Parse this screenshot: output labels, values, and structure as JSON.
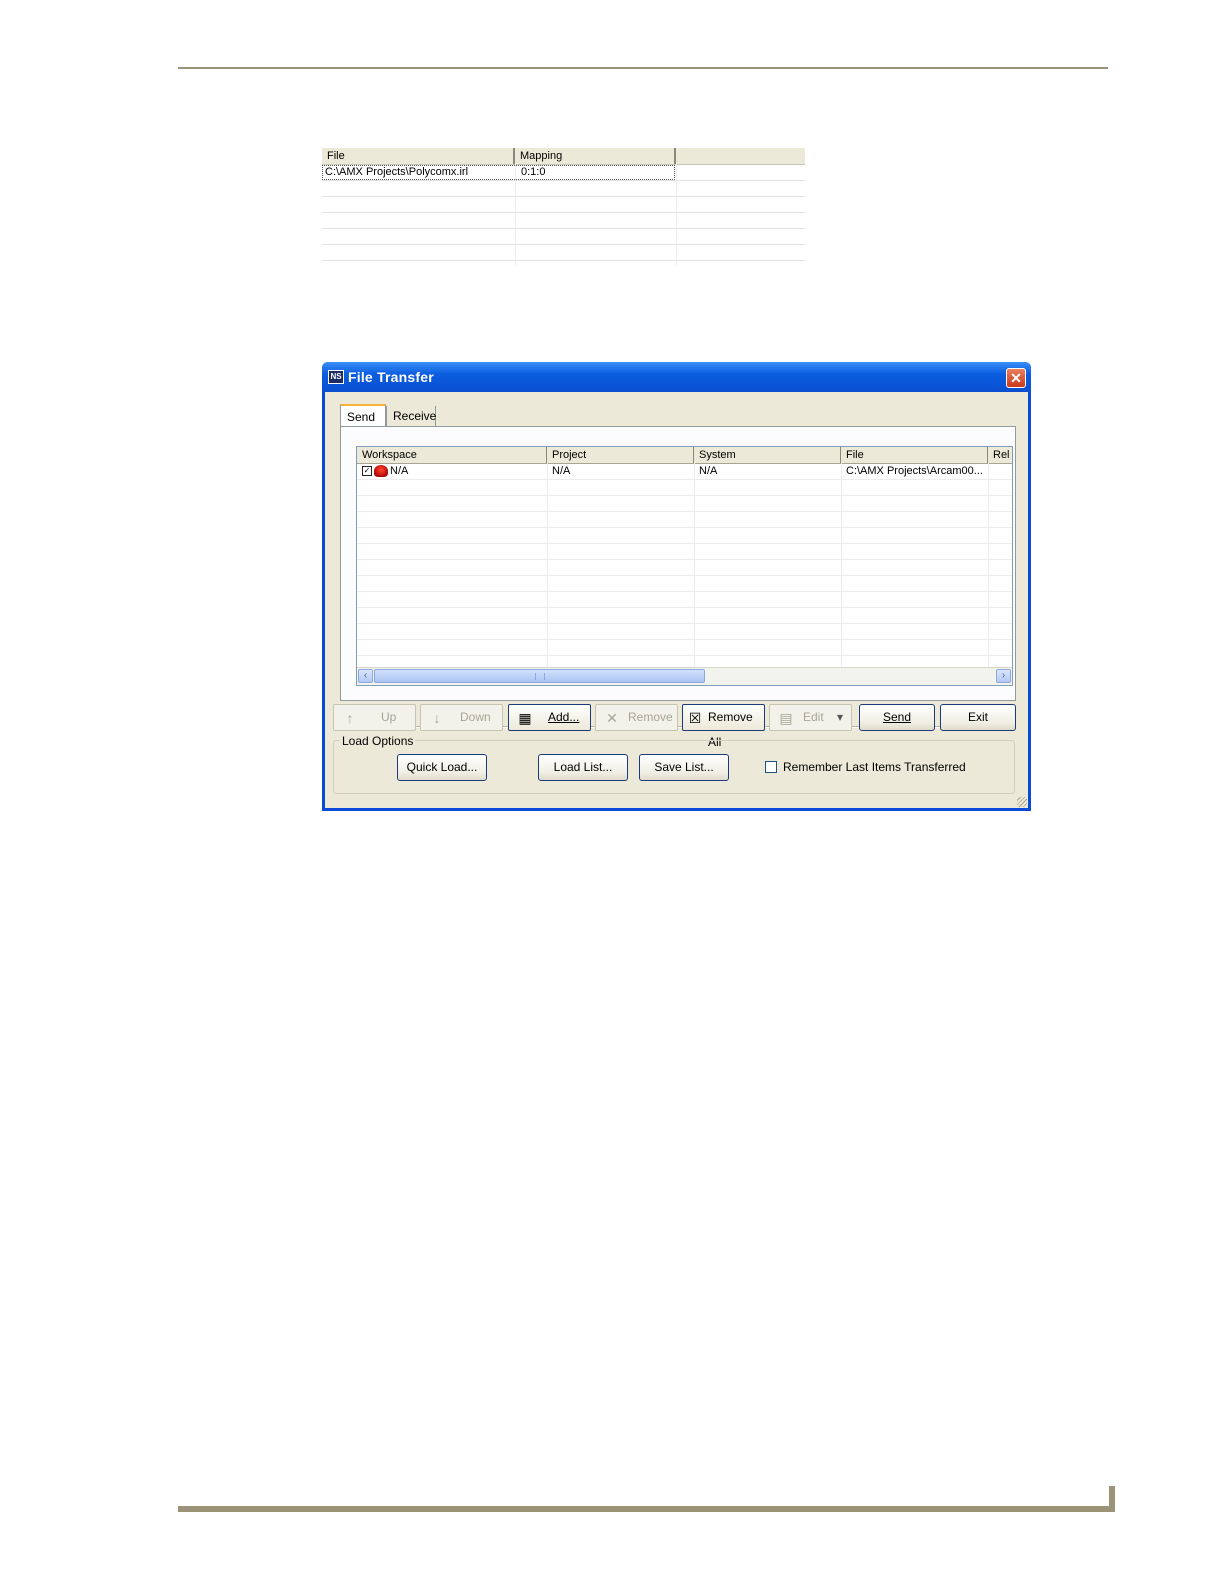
{
  "mapping_list": {
    "columns": [
      "File",
      "Mapping",
      ""
    ],
    "rows": [
      {
        "file": "C:\\AMX Projects\\Polycomx.irl",
        "mapping": "0:1:0"
      }
    ]
  },
  "dialog": {
    "title": "File Transfer",
    "app_icon": "NS",
    "close_icon": "✕",
    "tabs": [
      "Send",
      "Receive"
    ],
    "list": {
      "columns": [
        "Workspace",
        "Project",
        "System",
        "File",
        "Rel"
      ],
      "rows": [
        {
          "checked": true,
          "icon": "master-icon",
          "workspace": "N/A",
          "project": "N/A",
          "system": "N/A",
          "file": "C:\\AMX Projects\\Arcam00..."
        }
      ],
      "checkmark": "✓"
    },
    "scroll": {
      "left": "‹",
      "right": "›"
    },
    "toolbar": {
      "up": "Up",
      "down": "Down",
      "add": "Add...",
      "remove": "Remove",
      "remove_all": "Remove All",
      "edit": "Edit",
      "edit_arrow": "▾",
      "send": "Send",
      "exit": "Exit",
      "icons": {
        "up": "↑",
        "down": "↓",
        "add": "▦",
        "remove": "✕",
        "remove_all": "☒",
        "edit": "▤"
      }
    },
    "load_options": {
      "label": "Load Options",
      "quick_load": "Quick Load...",
      "load_list": "Load List...",
      "save_list": "Save List...",
      "remember_label": "Remember Last Items Transferred",
      "remember_checked": false
    }
  }
}
